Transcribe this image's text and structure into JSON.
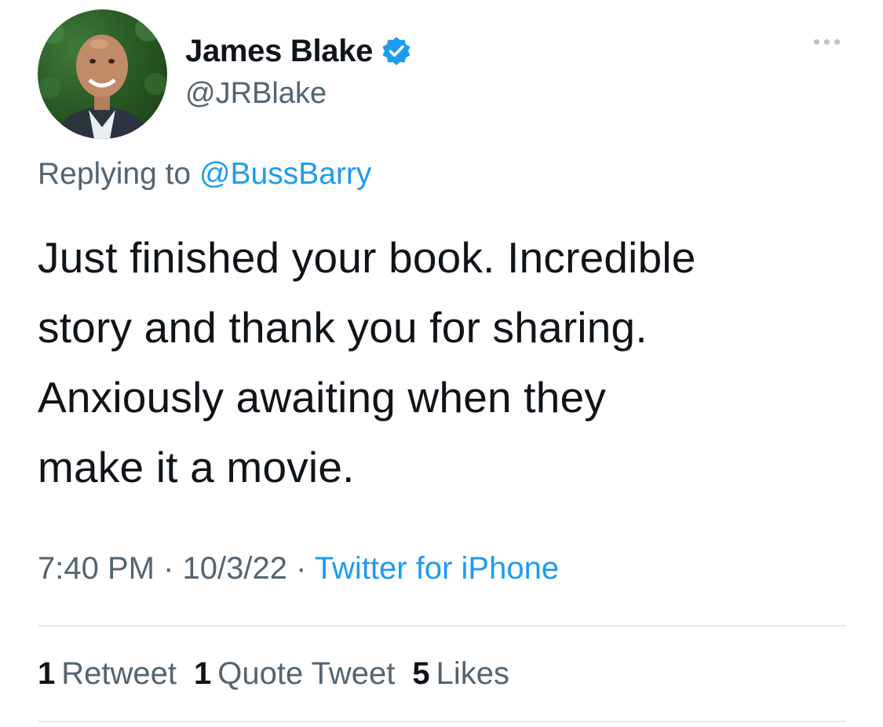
{
  "user": {
    "display_name": "James Blake",
    "handle": "@JRBlake",
    "verified_icon": "verified-badge-icon",
    "avatar_icon": "user-avatar"
  },
  "reply": {
    "prefix": "Replying to ",
    "mention": "@BussBarry"
  },
  "tweet": {
    "lines": [
      "Just finished your book.  Incredible",
      "story and thank you for sharing.",
      "Anxiously awaiting when they",
      "make it a movie."
    ]
  },
  "meta": {
    "time": "7:40 PM",
    "sep1": " · ",
    "date": "10/3/22",
    "sep2": " · ",
    "source": "Twitter for iPhone"
  },
  "stats": {
    "retweets_count": "1",
    "retweets_label": "Retweet",
    "quotes_count": "1",
    "quotes_label": "Quote Tweet",
    "likes_count": "5",
    "likes_label": "Likes"
  },
  "colors": {
    "text": "#0f1419",
    "secondary": "#536471",
    "link": "#1d9bf0",
    "divider": "#e4e8eb"
  }
}
